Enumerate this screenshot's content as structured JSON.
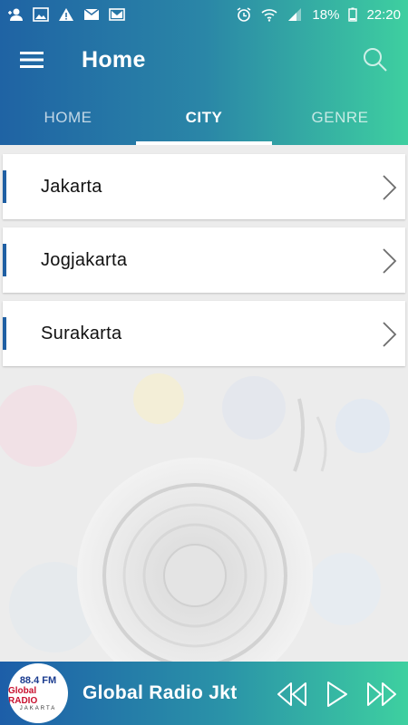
{
  "status_bar": {
    "battery": "18%",
    "time": "22:20"
  },
  "header": {
    "title": "Home"
  },
  "tabs": [
    {
      "label": "HOME"
    },
    {
      "label": "CITY"
    },
    {
      "label": "GENRE"
    }
  ],
  "cities": [
    {
      "name": "Jakarta"
    },
    {
      "name": "Jogjakarta"
    },
    {
      "name": "Surakarta"
    }
  ],
  "player": {
    "station": "Global Radio Jkt",
    "logo_line1": "88.4 FM",
    "logo_line2": "Global RADIO",
    "logo_line3": "JAKARTA"
  },
  "colors": {
    "accent": "#1f5fa3",
    "gradient_start": "#1f63a4",
    "gradient_end": "#3ecfa0"
  }
}
